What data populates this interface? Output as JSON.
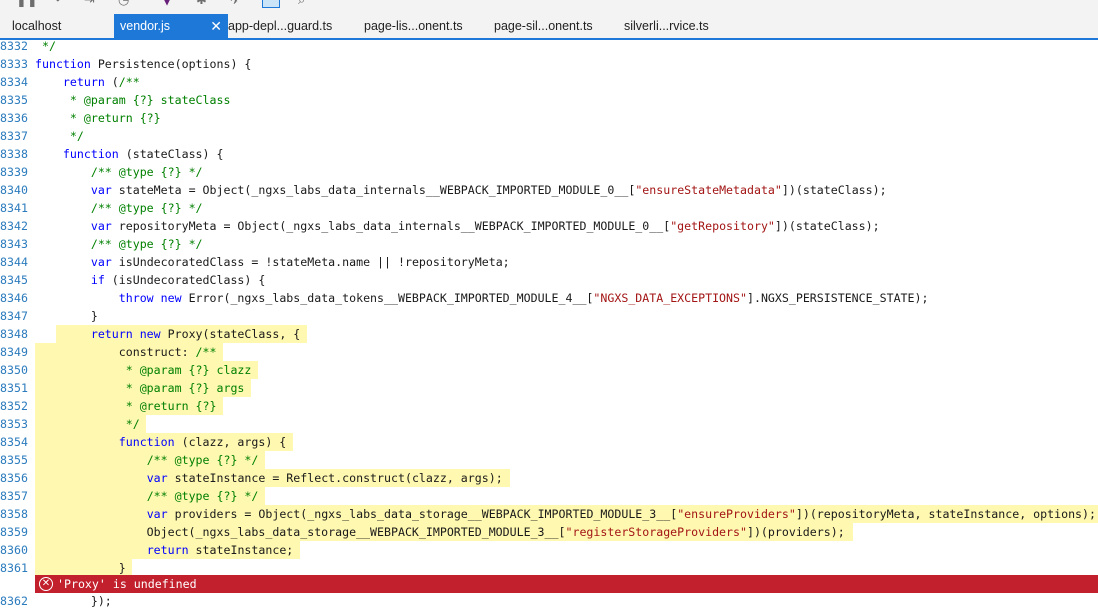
{
  "toolbar": {
    "icons": [
      "pause-icon",
      "step-over-icon",
      "step-out-icon",
      "new-session-icon",
      "vs-icon",
      "pin-icon",
      "break-all-icon",
      "find-icon"
    ]
  },
  "tabs": [
    {
      "label": "localhost",
      "active": false
    },
    {
      "label": "vendor.js",
      "active": true,
      "close": "✕"
    },
    {
      "label": "app-depl...guard.ts",
      "active": false
    },
    {
      "label": "page-lis...onent.ts",
      "active": false
    },
    {
      "label": "page-sil...onent.ts",
      "active": false
    },
    {
      "label": "silverli...rvice.ts",
      "active": false
    }
  ],
  "code": {
    "lines": [
      {
        "n": "8332",
        "hl": false,
        "html": " <span class=\"cm\">*/</span>"
      },
      {
        "n": "8333",
        "hl": false,
        "html": "<span class=\"kw\">function</span> Persistence(options) {"
      },
      {
        "n": "8334",
        "hl": false,
        "html": "    <span class=\"kw\">return</span> (<span class=\"cm\">/**</span>"
      },
      {
        "n": "8335",
        "hl": false,
        "html": "<span class=\"cm\">     * @param {?} stateClass</span>"
      },
      {
        "n": "8336",
        "hl": false,
        "html": "<span class=\"cm\">     * @return {?}</span>"
      },
      {
        "n": "8337",
        "hl": false,
        "html": "<span class=\"cm\">     */</span>"
      },
      {
        "n": "8338",
        "hl": false,
        "html": "    <span class=\"kw\">function</span> (stateClass) {"
      },
      {
        "n": "8339",
        "hl": false,
        "html": "        <span class=\"cm\">/** @type {?} */</span>"
      },
      {
        "n": "8340",
        "hl": false,
        "html": "        <span class=\"kw\">var</span> stateMeta = Object(_ngxs_labs_data_internals__WEBPACK_IMPORTED_MODULE_0__[<span class=\"str\">\"ensureStateMetadata\"</span>])(stateClass);"
      },
      {
        "n": "8341",
        "hl": false,
        "html": "        <span class=\"cm\">/** @type {?} */</span>"
      },
      {
        "n": "8342",
        "hl": false,
        "html": "        <span class=\"kw\">var</span> repositoryMeta = Object(_ngxs_labs_data_internals__WEBPACK_IMPORTED_MODULE_0__[<span class=\"str\">\"getRepository\"</span>])(stateClass);"
      },
      {
        "n": "8343",
        "hl": false,
        "html": "        <span class=\"cm\">/** @type {?} */</span>"
      },
      {
        "n": "8344",
        "hl": false,
        "html": "        <span class=\"kw\">var</span> isUndecoratedClass = !stateMeta.name || !repositoryMeta;"
      },
      {
        "n": "8345",
        "hl": false,
        "html": "        <span class=\"kw\">if</span> (isUndecoratedClass) {"
      },
      {
        "n": "8346",
        "hl": false,
        "html": "            <span class=\"kw\">throw new</span> Error(_ngxs_labs_data_tokens__WEBPACK_IMPORTED_MODULE_4__[<span class=\"str\">\"NGXS_DATA_EXCEPTIONS\"</span>].NGXS_PERSISTENCE_STATE);"
      },
      {
        "n": "8347",
        "hl": false,
        "html": "        }"
      },
      {
        "n": "8348",
        "hl": true,
        "hlStart": 3,
        "html": "        <span class=\"kw\">return new</span> Proxy(stateClass, {"
      },
      {
        "n": "8349",
        "hl": true,
        "html": "            construct: <span class=\"cm\">/**</span>"
      },
      {
        "n": "8350",
        "hl": true,
        "html": "<span class=\"cm\">             * @param {?} clazz</span>"
      },
      {
        "n": "8351",
        "hl": true,
        "html": "<span class=\"cm\">             * @param {?} args</span>"
      },
      {
        "n": "8352",
        "hl": true,
        "html": "<span class=\"cm\">             * @return {?}</span>"
      },
      {
        "n": "8353",
        "hl": true,
        "html": "<span class=\"cm\">             */</span>"
      },
      {
        "n": "8354",
        "hl": true,
        "html": "            <span class=\"kw\">function</span> (clazz, args) {"
      },
      {
        "n": "8355",
        "hl": true,
        "html": "                <span class=\"cm\">/** @type {?} */</span>"
      },
      {
        "n": "8356",
        "hl": true,
        "html": "                <span class=\"kw\">var</span> stateInstance = Reflect.construct(clazz, args);"
      },
      {
        "n": "8357",
        "hl": true,
        "html": "                <span class=\"cm\">/** @type {?} */</span>"
      },
      {
        "n": "8358",
        "hl": true,
        "html": "                <span class=\"kw\">var</span> providers = Object(_ngxs_labs_data_storage__WEBPACK_IMPORTED_MODULE_3__[<span class=\"str\">\"ensureProviders\"</span>])(repositoryMeta, stateInstance, options);"
      },
      {
        "n": "8359",
        "hl": true,
        "html": "                Object(_ngxs_labs_data_storage__WEBPACK_IMPORTED_MODULE_3__[<span class=\"str\">\"registerStorageProviders\"</span>])(providers);"
      },
      {
        "n": "8360",
        "hl": true,
        "html": "                <span class=\"kw\">return</span> stateInstance;"
      },
      {
        "n": "8361",
        "hl": true,
        "html": "            }"
      }
    ],
    "after_error": {
      "n": "8362",
      "html": "        });"
    }
  },
  "error": {
    "icon": "✕",
    "message": "'Proxy' is undefined"
  }
}
